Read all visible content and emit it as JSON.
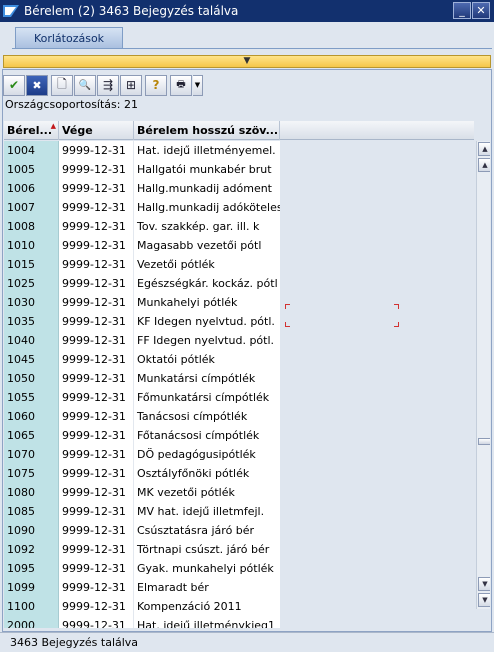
{
  "window": {
    "title": "Bérelem (2)  3463 Bejegyzés találva",
    "minimize_label": "_",
    "close_label": "✕"
  },
  "tabs": [
    {
      "label": "Korlátozások"
    }
  ],
  "collapse_arrow": "▼",
  "toolbar": [
    {
      "icon": "checkmark-icon",
      "glyph": "✔"
    },
    {
      "icon": "cancel-icon",
      "glyph": "✖"
    },
    {
      "icon": "new-document-icon",
      "glyph": "🗋"
    },
    {
      "icon": "find-icon",
      "glyph": "🔍"
    },
    {
      "icon": "find-next-icon",
      "glyph": "⇶"
    },
    {
      "icon": "filter-icon",
      "glyph": "⊞"
    },
    {
      "icon": "help-icon",
      "glyph": "?"
    },
    {
      "icon": "print-icon",
      "glyph": "🖶"
    }
  ],
  "info_line": "Országcsoportosítás: 21",
  "table": {
    "columns": [
      "Bérel...",
      "Vége",
      "Bérelem hosszú szöv..."
    ],
    "rows": [
      [
        "1004",
        "9999-12-31",
        "Hat. idejű illetményemel."
      ],
      [
        "1005",
        "9999-12-31",
        "Hallgatói munkabér brut"
      ],
      [
        "1006",
        "9999-12-31",
        "Hallg.munkadĳ adóment"
      ],
      [
        "1007",
        "9999-12-31",
        "Hallg.munkadĳ adóköteles"
      ],
      [
        "1008",
        "9999-12-31",
        "Tov. szakkép. gar. ill. k"
      ],
      [
        "1010",
        "9999-12-31",
        "Magasabb vezetői pótl"
      ],
      [
        "1015",
        "9999-12-31",
        "Vezetői pótlék"
      ],
      [
        "1025",
        "9999-12-31",
        "Egészségkár. kockáz. pótl"
      ],
      [
        "1030",
        "9999-12-31",
        "Munkahelyi pótlék"
      ],
      [
        "1035",
        "9999-12-31",
        "KF Idegen nyelvtud. pótl."
      ],
      [
        "1040",
        "9999-12-31",
        "FF Idegen nyelvtud. pótl."
      ],
      [
        "1045",
        "9999-12-31",
        "Oktatói pótlék"
      ],
      [
        "1050",
        "9999-12-31",
        "Munkatársi címpótlék"
      ],
      [
        "1055",
        "9999-12-31",
        "Főmunkatársi címpótlék"
      ],
      [
        "1060",
        "9999-12-31",
        "Tanácsosi címpótlék"
      ],
      [
        "1065",
        "9999-12-31",
        "Főtanácsosi címpótlék"
      ],
      [
        "1070",
        "9999-12-31",
        "DÖ pedagógusipótlék"
      ],
      [
        "1075",
        "9999-12-31",
        "Osztályfőnöki pótlék"
      ],
      [
        "1080",
        "9999-12-31",
        "MK vezetői pótlék"
      ],
      [
        "1085",
        "9999-12-31",
        "MV hat. idejű illetmfejl."
      ],
      [
        "1090",
        "9999-12-31",
        "Csúsztatásra járó bér"
      ],
      [
        "1092",
        "9999-12-31",
        "Törtnapi csúszt. járó bér"
      ],
      [
        "1095",
        "9999-12-31",
        "Gyak. munkahelyi pótlék"
      ],
      [
        "1099",
        "9999-12-31",
        "Elmaradt bér"
      ],
      [
        "1100",
        "9999-12-31",
        "Kompenzáció 2011"
      ],
      [
        "2000",
        "9999-12-31",
        "Hat. idejű illetménykieg1"
      ]
    ]
  },
  "scrollbar": {
    "up": "▲",
    "down": "▼"
  },
  "status_bar": "3463 Bejegyzés találva",
  "colors": {
    "titlebar": "#12306e",
    "key_column": "#bfe2e6",
    "collapse_bar": "#f5c64a",
    "focus_marker": "#d23232"
  }
}
